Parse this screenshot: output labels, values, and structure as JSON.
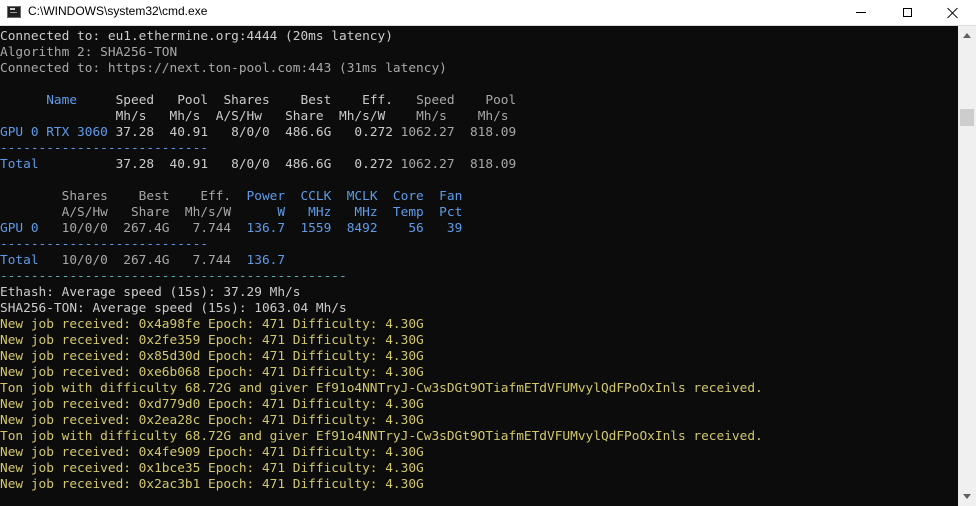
{
  "window": {
    "title": "C:\\WINDOWS\\system32\\cmd.exe"
  },
  "icons": {
    "app": "cmd-icon",
    "minimize": "minimize-icon",
    "maximize": "maximize-icon",
    "close": "close-icon"
  },
  "colors": {
    "white": "#cccccc",
    "gray": "#a8a8a8",
    "blue": "#5f9be8",
    "teal": "#58b0b0",
    "yellow": "#d2c86a",
    "background": "#0c0c0c"
  },
  "console": {
    "lines": [
      {
        "row": 0,
        "parts": [
          {
            "text": "Connected to: eu1.ethermine.org:4444 (20ms latency)",
            "color": "#cccccc"
          }
        ]
      },
      {
        "row": 1,
        "parts": [
          {
            "text": "Algorithm 2: SHA256-TON",
            "color": "#a8a8a8"
          }
        ]
      },
      {
        "row": 2,
        "parts": [
          {
            "text": "Connected to: https://next.ton-pool.com:443 (31ms latency)",
            "color": "#a8a8a8"
          }
        ]
      },
      {
        "row": 4,
        "parts": [
          {
            "text": "      Name     ",
            "color": "#5f9be8"
          },
          {
            "text": "Speed   Pool  Shares    Best    Eff.   ",
            "color": "#cccccc"
          },
          {
            "text": "Speed    Pool",
            "color": "#a8a8a8"
          }
        ]
      },
      {
        "row": 5,
        "parts": [
          {
            "text": "               ",
            "color": "#cccccc"
          },
          {
            "text": "Mh/s   Mh/s  A/S/Hw   Share  Mh/s/W    ",
            "color": "#cccccc"
          },
          {
            "text": "Mh/s    Mh/s",
            "color": "#a8a8a8"
          }
        ]
      },
      {
        "row": 6,
        "parts": [
          {
            "text": "GPU 0 RTX 3060 ",
            "color": "#5f9be8"
          },
          {
            "text": "37.28  40.91   8/0/0  486.6G   0.272 ",
            "color": "#cccccc"
          },
          {
            "text": "1062.27  818.09",
            "color": "#a8a8a8"
          }
        ]
      },
      {
        "row": 7,
        "parts": [
          {
            "text": "---------------------------",
            "color": "#5f9be8"
          }
        ]
      },
      {
        "row": 8,
        "parts": [
          {
            "text": "Total          ",
            "color": "#5f9be8"
          },
          {
            "text": "37.28  40.91   8/0/0  486.6G   0.272 ",
            "color": "#cccccc"
          },
          {
            "text": "1062.27  818.09",
            "color": "#a8a8a8"
          }
        ]
      },
      {
        "row": 10,
        "parts": [
          {
            "text": "        Shares    Best    Eff. ",
            "color": "#a8a8a8"
          },
          {
            "text": " Power  CCLK  MCLK  Core  Fan",
            "color": "#5f9be8"
          }
        ]
      },
      {
        "row": 11,
        "parts": [
          {
            "text": "        A/S/Hw   Share  Mh/s/W ",
            "color": "#a8a8a8"
          },
          {
            "text": "     W   MHz   MHz  Temp  Pct",
            "color": "#5f9be8"
          }
        ]
      },
      {
        "row": 12,
        "parts": [
          {
            "text": "GPU 0  ",
            "color": "#5f9be8"
          },
          {
            "text": " 10/0/0  267.4G   7.744 ",
            "color": "#a8a8a8"
          },
          {
            "text": " 136.7  1559  8492    56   39",
            "color": "#5f9be8"
          }
        ]
      },
      {
        "row": 13,
        "parts": [
          {
            "text": "---------------------------",
            "color": "#5f9be8"
          }
        ]
      },
      {
        "row": 14,
        "parts": [
          {
            "text": "Total  ",
            "color": "#5f9be8"
          },
          {
            "text": " 10/0/0  267.4G   7.744 ",
            "color": "#a8a8a8"
          },
          {
            "text": " 136.7",
            "color": "#5f9be8"
          }
        ]
      },
      {
        "row": 15,
        "parts": [
          {
            "text": "---------------------------------------------",
            "color": "#58b0b0"
          }
        ]
      },
      {
        "row": 16,
        "parts": [
          {
            "text": "Ethash: Average speed (15s): 37.29 Mh/s",
            "color": "#cccccc"
          }
        ]
      },
      {
        "row": 17,
        "parts": [
          {
            "text": "SHA256-TON: Average speed (15s): 1063.04 Mh/s",
            "color": "#cccccc"
          }
        ]
      },
      {
        "row": 18,
        "parts": [
          {
            "text": "New job received: 0x4a98fe Epoch: 471 Difficulty: 4.30G",
            "color": "#d2c86a"
          }
        ]
      },
      {
        "row": 19,
        "parts": [
          {
            "text": "New job received: 0x2fe359 Epoch: 471 Difficulty: 4.30G",
            "color": "#d2c86a"
          }
        ]
      },
      {
        "row": 20,
        "parts": [
          {
            "text": "New job received: 0x85d30d Epoch: 471 Difficulty: 4.30G",
            "color": "#d2c86a"
          }
        ]
      },
      {
        "row": 21,
        "parts": [
          {
            "text": "New job received: 0xe6b068 Epoch: 471 Difficulty: 4.30G",
            "color": "#d2c86a"
          }
        ]
      },
      {
        "row": 22,
        "parts": [
          {
            "text": "Ton job with difficulty 68.72G and giver Ef91o4NNTryJ-Cw3sDGt9OTiafmETdVFUMvylQdFPoOxInls received.",
            "color": "#d2c86a"
          }
        ]
      },
      {
        "row": 23,
        "parts": [
          {
            "text": "New job received: 0xd779d0 Epoch: 471 Difficulty: 4.30G",
            "color": "#d2c86a"
          }
        ]
      },
      {
        "row": 24,
        "parts": [
          {
            "text": "New job received: 0x2ea28c Epoch: 471 Difficulty: 4.30G",
            "color": "#d2c86a"
          }
        ]
      },
      {
        "row": 25,
        "parts": [
          {
            "text": "Ton job with difficulty 68.72G and giver Ef91o4NNTryJ-Cw3sDGt9OTiafmETdVFUMvylQdFPoOxInls received.",
            "color": "#d2c86a"
          }
        ]
      },
      {
        "row": 26,
        "parts": [
          {
            "text": "New job received: 0x4fe909 Epoch: 471 Difficulty: 4.30G",
            "color": "#d2c86a"
          }
        ]
      },
      {
        "row": 27,
        "parts": [
          {
            "text": "New job received: 0x1bce35 Epoch: 471 Difficulty: 4.30G",
            "color": "#d2c86a"
          }
        ]
      },
      {
        "row": 28,
        "parts": [
          {
            "text": "New job received: 0x2ac3b1 Epoch: 471 Difficulty: 4.30G",
            "color": "#d2c86a"
          }
        ]
      }
    ]
  }
}
